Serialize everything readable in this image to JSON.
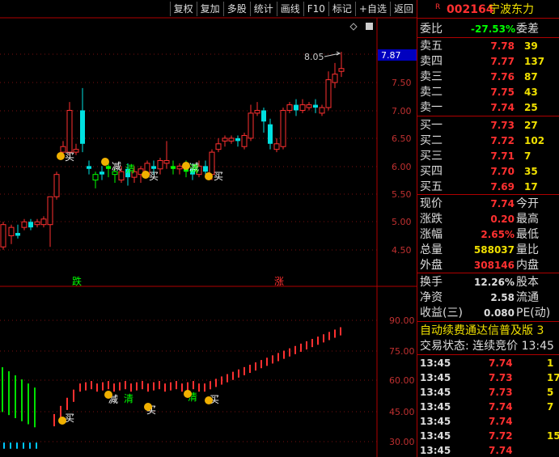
{
  "toolbar": {
    "items": [
      "复权",
      "复加",
      "多股",
      "统计",
      "画线",
      "F10",
      "标记",
      "+自选",
      "返回"
    ]
  },
  "main_chart": {
    "y_ticks": [
      "7.50",
      "7.00",
      "6.50",
      "6.00",
      "5.50",
      "5.00",
      "4.50"
    ],
    "current_price": "7.87",
    "high_label": "8.05",
    "markers": [
      {
        "text": "买",
        "color": "#ffffff"
      },
      {
        "text": "减",
        "color": "#ffffff"
      },
      {
        "text": "清",
        "color": "#00ff00"
      },
      {
        "text": "买",
        "color": "#ffffff"
      },
      {
        "text": "减",
        "color": "#ffffff"
      },
      {
        "text": "清",
        "color": "#00ff00"
      },
      {
        "text": "买",
        "color": "#ffffff"
      }
    ],
    "bottom_tags": [
      {
        "text": "跌",
        "color": "#00ff00"
      },
      {
        "text": "涨",
        "color": "#ff3030"
      }
    ]
  },
  "sub_chart": {
    "y_ticks": [
      "90.00",
      "75.00",
      "60.00",
      "45.00",
      "30.00"
    ],
    "markers": [
      {
        "text": "买",
        "color": "#ffffff"
      },
      {
        "text": "减",
        "color": "#ffffff"
      },
      {
        "text": "清",
        "color": "#00ff00"
      },
      {
        "text": "买",
        "color": "#ffffff"
      },
      {
        "text": "清",
        "color": "#00ff00"
      },
      {
        "text": "买",
        "color": "#ffffff"
      }
    ]
  },
  "quote": {
    "r_badge": "R",
    "code": "002164",
    "name": "宁波东力",
    "weibi_label": "委比",
    "weibi_value": "-27.53%",
    "weicha_label": "委差",
    "sells": [
      {
        "label": "卖五",
        "price": "7.78",
        "vol": "39"
      },
      {
        "label": "卖四",
        "price": "7.77",
        "vol": "137"
      },
      {
        "label": "卖三",
        "price": "7.76",
        "vol": "87"
      },
      {
        "label": "卖二",
        "price": "7.75",
        "vol": "43"
      },
      {
        "label": "卖一",
        "price": "7.74",
        "vol": "25"
      }
    ],
    "buys": [
      {
        "label": "买一",
        "price": "7.73",
        "vol": "27"
      },
      {
        "label": "买二",
        "price": "7.72",
        "vol": "102"
      },
      {
        "label": "买三",
        "price": "7.71",
        "vol": "7"
      },
      {
        "label": "买四",
        "price": "7.70",
        "vol": "35"
      },
      {
        "label": "买五",
        "price": "7.69",
        "vol": "17"
      }
    ],
    "stats1": [
      {
        "l": "现价",
        "v": "7.74",
        "c": "red",
        "r": "今开"
      },
      {
        "l": "涨跌",
        "v": "0.20",
        "c": "red",
        "r": "最高"
      },
      {
        "l": "涨幅",
        "v": "2.65%",
        "c": "red",
        "r": "最低"
      },
      {
        "l": "总量",
        "v": "588037",
        "c": "yel",
        "r": "量比"
      },
      {
        "l": "外盘",
        "v": "308146",
        "c": "red",
        "r": "内盘"
      }
    ],
    "stats2": [
      {
        "l": "换手",
        "v": "12.26%",
        "c": "wht",
        "r": "股本"
      },
      {
        "l": "净资",
        "v": "2.58",
        "c": "wht",
        "r": "流通"
      },
      {
        "l": "收益(三)",
        "v": "0.080",
        "c": "wht",
        "r": "PE(动)"
      }
    ],
    "promo": "自动续费通达信普及版 3",
    "trade_status": "交易状态: 连续竞价 13:45",
    "ticks": [
      {
        "t": "13:45",
        "p": "7.74",
        "pc": "red",
        "v": "1"
      },
      {
        "t": "13:45",
        "p": "7.73",
        "pc": "red",
        "v": "17"
      },
      {
        "t": "13:45",
        "p": "7.73",
        "pc": "red",
        "v": "5"
      },
      {
        "t": "13:45",
        "p": "7.74",
        "pc": "red",
        "v": "7"
      },
      {
        "t": "13:45",
        "p": "7.74",
        "pc": "red",
        "v": ""
      },
      {
        "t": "13:45",
        "p": "7.72",
        "pc": "red",
        "v": "15"
      },
      {
        "t": "13:45",
        "p": "7.74",
        "pc": "red",
        "v": ""
      }
    ]
  }
}
